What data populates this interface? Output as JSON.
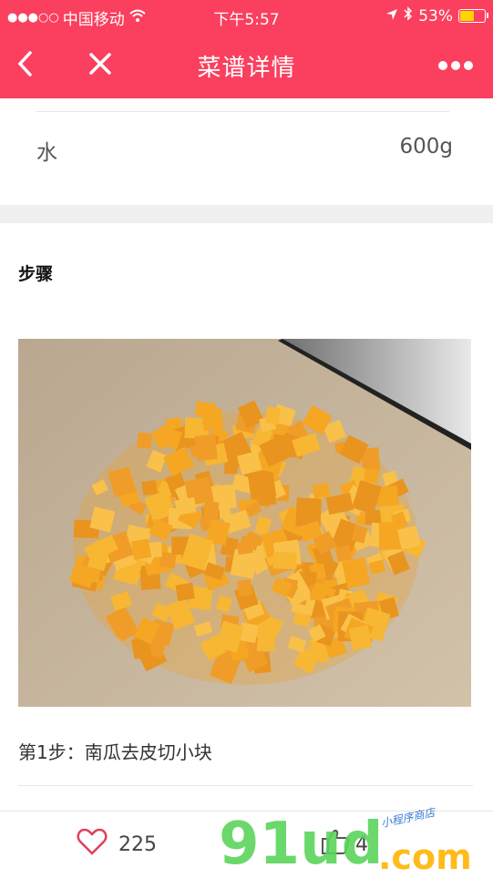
{
  "status_bar": {
    "carrier": "中国移动",
    "time": "下午5:57",
    "battery": "53%",
    "battery_level": 0.53,
    "signal_icon": "signal-dots-icon",
    "wifi_icon": "wifi-icon",
    "location_icon": "location-arrow-icon",
    "bluetooth_icon": "bluetooth-icon"
  },
  "nav": {
    "title": "菜谱详情",
    "back_icon": "back-chevron-icon",
    "close_icon": "close-icon",
    "more_icon": "more-dots-icon"
  },
  "ingredients": [
    {
      "name": "水",
      "amount": "600g"
    }
  ],
  "steps_section": {
    "title": "步骤",
    "steps": [
      {
        "text": "第1步：南瓜去皮切小块",
        "image": "diced-pumpkin-photo"
      }
    ]
  },
  "bottom_bar": {
    "likes_count": "225",
    "likes_icon": "heart-outline-icon",
    "thumbs_count": "4",
    "thumbs_icon": "thumbs-up-icon"
  },
  "watermark": {
    "logo_text": "91ud",
    "logo_suffix": ".com",
    "subtitle": "小程序商店"
  },
  "colors": {
    "brand": "#fb3f5e",
    "pumpkin": "#f5a623",
    "watermark_green": "#5ad45a",
    "watermark_yellow": "#ffb400"
  }
}
